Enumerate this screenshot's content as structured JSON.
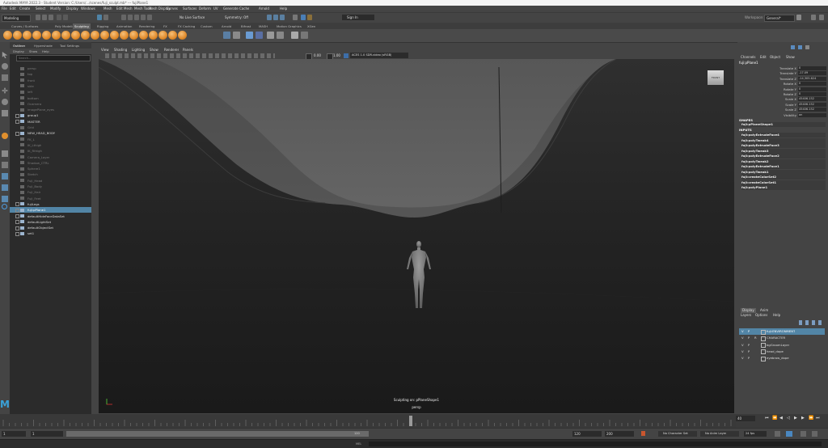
{
  "title": "Autodesk MAYA 2022.3 - Student Version: C:/Users/.../scenes/fuji_sculpt.mb* --- fujiPlane1",
  "menus": [
    "File",
    "Edit",
    "Create",
    "Select",
    "Modify",
    "Display",
    "Windows",
    "Mesh",
    "Edit Mesh",
    "Mesh Tools",
    "Mesh Display",
    "Curves",
    "Surfaces",
    "Deform",
    "UV",
    "Generate",
    "Cache",
    "Arnold",
    "Help"
  ],
  "status": {
    "mode": "Modeling",
    "live_surface": "No Live Surface",
    "symmetry": "Symmetry: Off",
    "sign_in": "Sign In",
    "workspace_label": "Workspace:",
    "workspace_value": "General*"
  },
  "shelf_tabs": [
    "Curves / Surfaces",
    "Poly Modeling",
    "Sculpting",
    "Rigging",
    "Animation",
    "Rendering",
    "FX",
    "FX Caching",
    "Custom",
    "Arnold",
    "Bifrost",
    "MASH",
    "Motion Graphics",
    "XGen"
  ],
  "active_shelf_tab": "Sculpting",
  "outliner": {
    "tabs": [
      "Outliner",
      "Hypershade",
      "Tool Settings"
    ],
    "menu": [
      "Display",
      "Show",
      "Help"
    ],
    "search_placeholder": "Search...",
    "items": [
      {
        "label": "persp",
        "dim": true
      },
      {
        "label": "top",
        "dim": true
      },
      {
        "label": "front",
        "dim": true
      },
      {
        "label": "side",
        "dim": true
      },
      {
        "label": "left",
        "dim": true
      },
      {
        "label": "bottom",
        "dim": true
      },
      {
        "label": "Ocamera",
        "dim": true
      },
      {
        "label": "imagePlane_eyes",
        "dim": true
      },
      {
        "label": "group1",
        "dim": false
      },
      {
        "label": "MASTER",
        "dim": false
      },
      {
        "label": "Grid",
        "dim": true
      },
      {
        "label": "NEW_HEAD_BODY",
        "dim": false
      },
      {
        "label": "FK_L",
        "dim": true
      },
      {
        "label": "IK_Lthigh",
        "dim": true
      },
      {
        "label": "IK_Rthigh",
        "dim": true
      },
      {
        "label": "Camera_Layer",
        "dim": true
      },
      {
        "label": "Shadow_CTRL",
        "dim": true
      },
      {
        "label": "Sphere1",
        "dim": true
      },
      {
        "label": "Sketch",
        "dim": true
      },
      {
        "label": "Fuji_Head",
        "dim": true
      },
      {
        "label": "Fuji_Body",
        "dim": true
      },
      {
        "label": "Fuji_Hair",
        "dim": true
      },
      {
        "label": "Fuji_Feet",
        "dim": true
      },
      {
        "label": "fujiLegs",
        "dim": false
      },
      {
        "label": "fuji:pPlane1",
        "dim": false,
        "selected": true
      },
      {
        "label": "defaultHideFaceDataSet",
        "dim": false
      },
      {
        "label": "defaultLightSet",
        "dim": false
      },
      {
        "label": "defaultObjectSet",
        "dim": false
      },
      {
        "label": "set1",
        "dim": false
      }
    ]
  },
  "viewport": {
    "menu": [
      "View",
      "Shading",
      "Lighting",
      "Show",
      "Renderer",
      "Panels"
    ],
    "exposure": "0.00",
    "gamma": "1.00",
    "colorspace": "ACES 1.0 SDR-video (sRGB)",
    "hud_line1": "Sculpting on: pPlaneShape1",
    "hud_line2": "persp",
    "viewcube_label": "FRONT"
  },
  "channel_box": {
    "menu": [
      "Channels",
      "Edit",
      "Object",
      "Show"
    ],
    "node": "fuji:pPlane1",
    "attributes": [
      {
        "name": "Translate X",
        "value": "0"
      },
      {
        "name": "Translate Y",
        "value": "-17.09"
      },
      {
        "name": "Translate Z",
        "value": "-14,305.624"
      },
      {
        "name": "Rotate X",
        "value": "0"
      },
      {
        "name": "Rotate Y",
        "value": "0"
      },
      {
        "name": "Rotate Z",
        "value": "0"
      },
      {
        "name": "Scale X",
        "value": "45406.152"
      },
      {
        "name": "Scale Y",
        "value": "45406.152"
      },
      {
        "name": "Scale Z",
        "value": "45406.152"
      },
      {
        "name": "Visibility",
        "value": "on"
      }
    ],
    "shapes_header": "SHAPES",
    "shapes": [
      "fuji:pPlaneShape1"
    ],
    "inputs_header": "INPUTS",
    "inputs": [
      "fuji:polyExtrudeFace4",
      "fuji:polyTweak4",
      "fuji:polyExtrudeFace3",
      "fuji:polyTweak3",
      "fuji:polyExtrudeFace2",
      "fuji:polyTweak2",
      "fuji:polyExtrudeFace1",
      "fuji:polyTweak1",
      "fuji:createColorSet2",
      "fuji:createColorSet1",
      "fuji:polyPlane1"
    ]
  },
  "layers": {
    "tabs": [
      "Display",
      "Anim"
    ],
    "menu": [
      "Layers",
      "Options",
      "Help"
    ],
    "rows": [
      {
        "v": "V",
        "p": "P",
        "r": "",
        "name": "fuji:ENVIRONMENT",
        "selected": true
      },
      {
        "v": "V",
        "p": "P",
        "r": "R",
        "name": "CHARACTER",
        "selected": false
      },
      {
        "v": "V",
        "p": "P",
        "r": "",
        "name": "bgGroomLayer",
        "selected": false
      },
      {
        "v": "V",
        "p": "P",
        "r": "",
        "name": "head_dope",
        "selected": false
      },
      {
        "v": "V",
        "p": "P",
        "r": "",
        "name": "eyebrow_dope",
        "selected": false
      }
    ]
  },
  "timeline": {
    "current_frame": "40",
    "range_start": "1",
    "range_start2": "1",
    "range_end": "120",
    "range_end2": "120",
    "range_end3": "200",
    "range_mid": "120",
    "char_set": "No Character Set",
    "anim_layer": "No Anim Layer",
    "fps": "24 fps",
    "mel_label": "MEL"
  }
}
